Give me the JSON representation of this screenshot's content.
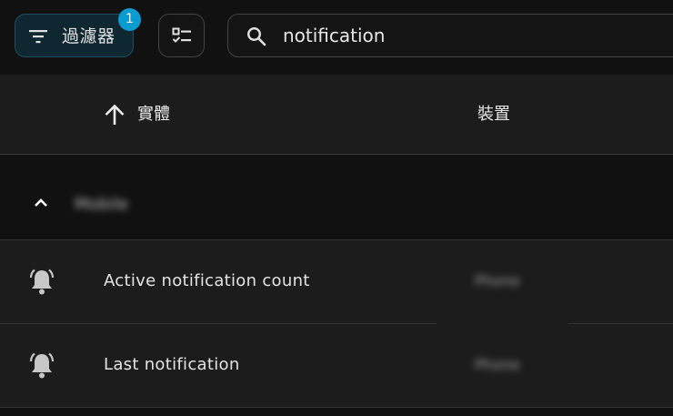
{
  "toolbar": {
    "filter_label": "過濾器",
    "filter_badge": "1",
    "search": {
      "value": "notification",
      "placeholder": ""
    },
    "icons": {
      "filter": "filter-lines-icon",
      "select": "checklist-icon",
      "search": "magnify-icon"
    }
  },
  "table": {
    "columns": {
      "entity": "實體",
      "device": "裝置",
      "sort_direction": "ascending"
    },
    "group": {
      "name": "Mobile",
      "expanded": true
    },
    "rows": [
      {
        "icon": "bell-ring-icon",
        "name": "Active notification count",
        "device": "Phone"
      },
      {
        "icon": "bell-ring-icon",
        "name": "Last notification",
        "device": "Phone"
      }
    ]
  },
  "colors": {
    "accent": "#0a9bd1",
    "filter_bg": "#0f2730",
    "filter_border": "#1f4f60",
    "row_bg": "#1c1c1c",
    "page_bg": "#111111"
  }
}
